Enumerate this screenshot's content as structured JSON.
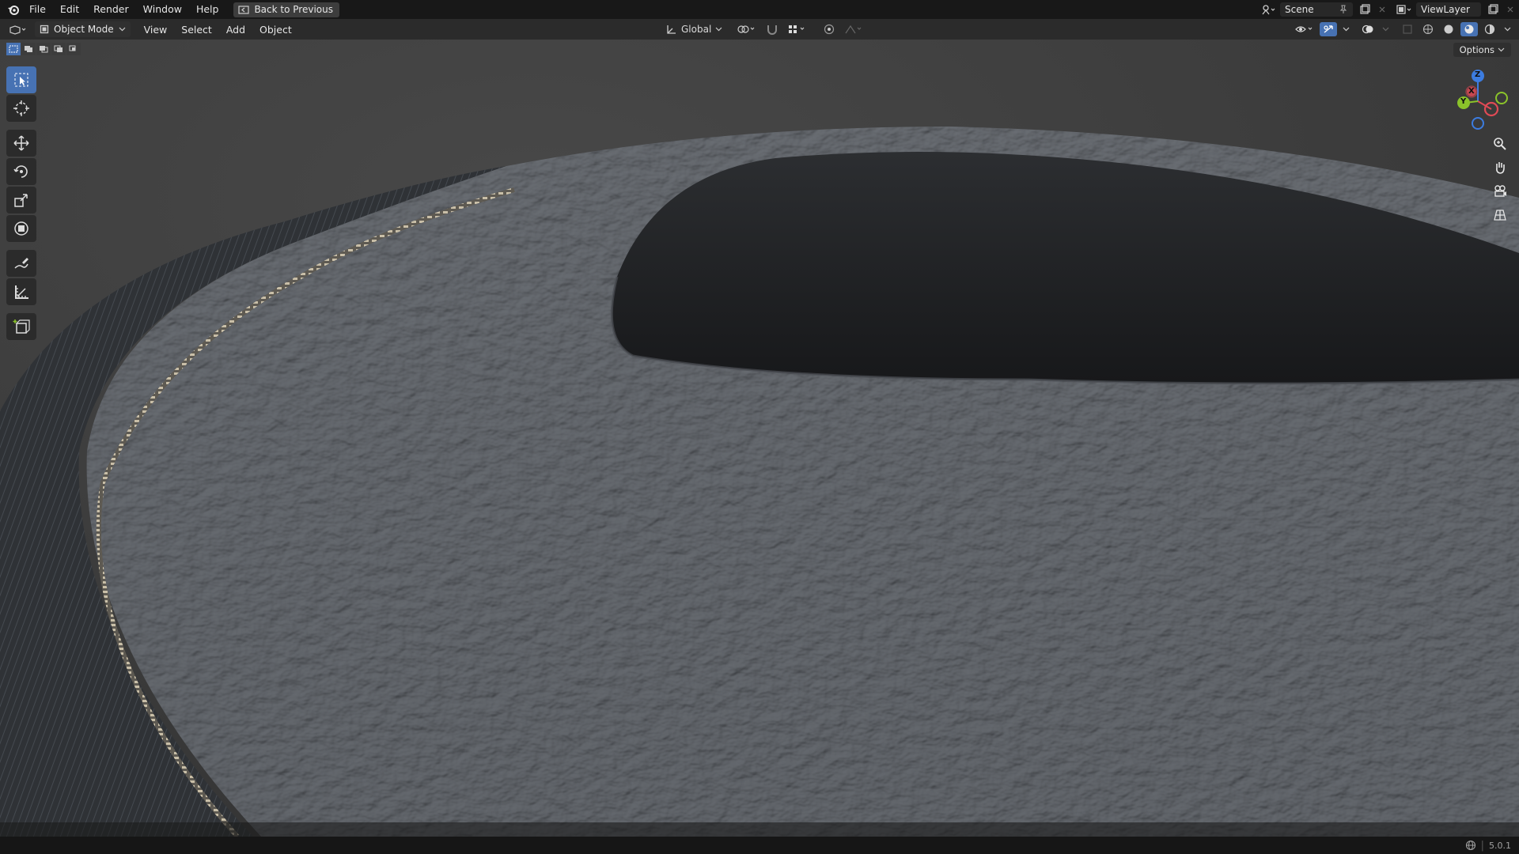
{
  "topbar": {
    "menus": [
      "File",
      "Edit",
      "Render",
      "Window",
      "Help"
    ],
    "back_button": "Back to Previous",
    "scene": "Scene",
    "view_layer": "ViewLayer"
  },
  "header": {
    "mode": "Object Mode",
    "menus": [
      "View",
      "Select",
      "Add",
      "Object"
    ],
    "orientation": "Global"
  },
  "viewport": {
    "options_label": "Options",
    "gizmo_axes": {
      "x": "X",
      "y": "Y",
      "z": "Z"
    }
  },
  "statusbar": {
    "version": "5.0.1"
  },
  "colors": {
    "accent": "#4772b3",
    "background": "#3a3a3a",
    "topbar": "#181818",
    "axis_x": "#e04a55",
    "axis_y": "#8bc32a",
    "axis_z": "#3c7ce0"
  }
}
